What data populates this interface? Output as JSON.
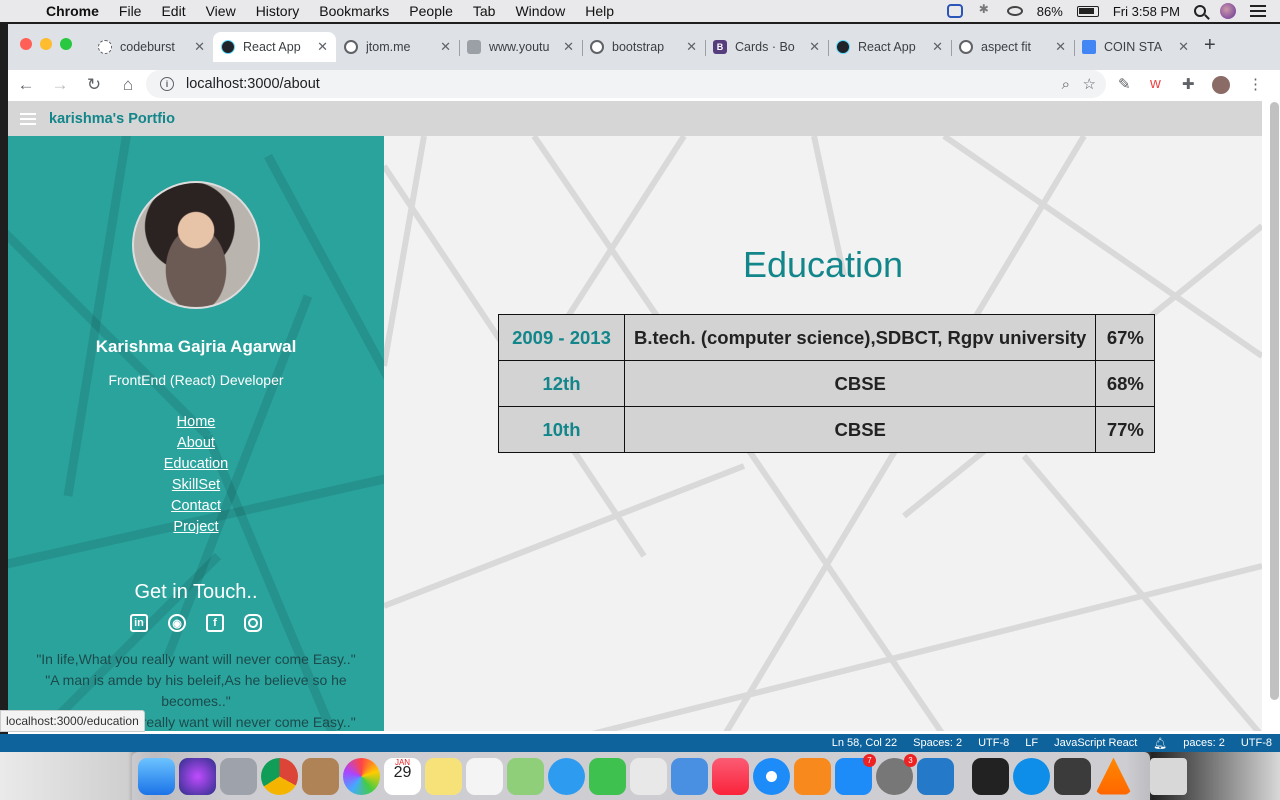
{
  "menubar": {
    "app_name": "Chrome",
    "items": [
      "File",
      "Edit",
      "View",
      "History",
      "Bookmarks",
      "People",
      "Tab",
      "Window",
      "Help"
    ],
    "battery": "86%",
    "clock": "Fri 3:58 PM"
  },
  "browser": {
    "tabs": [
      {
        "title": "codeburst",
        "icon": "codeburst-icon"
      },
      {
        "title": "React App",
        "icon": "react-icon"
      },
      {
        "title": "jtom.me",
        "icon": "globe-icon"
      },
      {
        "title": "www.youtu",
        "icon": "youtube-icon"
      },
      {
        "title": "bootstrap",
        "icon": "globe-icon"
      },
      {
        "title": "Cards · Bo",
        "icon": "bootstrap-icon",
        "badge": "B"
      },
      {
        "title": "React App",
        "icon": "react-icon"
      },
      {
        "title": "aspect fit",
        "icon": "globe-icon"
      },
      {
        "title": "COIN STA",
        "icon": "docs-icon"
      }
    ],
    "active_tab_index": 1,
    "url": "localhost:3000/about",
    "hover_link": "localhost:3000/education"
  },
  "page": {
    "brand": "karishma's Portfio",
    "profile": {
      "name": "Karishma Gajria Agarwal",
      "role": "FrontEnd (React) Developer"
    },
    "nav": [
      "Home",
      "About",
      "Education",
      "SkillSet",
      "Contact",
      "Project"
    ],
    "get_in_touch": "Get in Touch..",
    "socials": [
      "linkedin-icon",
      "github-icon",
      "facebook-icon",
      "instagram-icon"
    ],
    "quotes": [
      "\"In life,What you really want will never come Easy..\"",
      "\"A man is amde by his beleif,As he believe so he becomes..\"",
      "\"In life,What you really want will never come Easy..\""
    ],
    "education": {
      "title": "Education",
      "rows": [
        {
          "year": "2009 - 2013",
          "degree": "B.tech. (computer science),SDBCT, Rgpv university",
          "percent": "67%"
        },
        {
          "year": "12th",
          "degree": "CBSE",
          "percent": "68%"
        },
        {
          "year": "10th",
          "degree": "CBSE",
          "percent": "77%"
        }
      ]
    }
  },
  "editor_status": {
    "position": "Ln 58, Col 22",
    "spaces": "Spaces: 2",
    "encoding": "UTF-8",
    "eol": "LF",
    "language": "JavaScript React",
    "spaces2": "paces: 2",
    "encoding2": "UTF-8"
  },
  "dock": {
    "calendar_month": "JAN",
    "calendar_day": "29",
    "badges": {
      "app_store": "7",
      "system_prefs": "3"
    }
  },
  "colors": {
    "teal": "#2aa39d",
    "teal_text": "#12868a",
    "appbar": "#d6d6d6"
  }
}
